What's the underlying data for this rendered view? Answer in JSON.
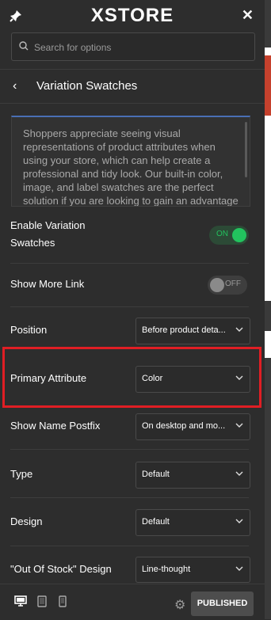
{
  "header": {
    "logo": "XSTORE",
    "close_label": "✕"
  },
  "search": {
    "placeholder": "Search for options"
  },
  "section": {
    "back_label": "‹",
    "title": "Variation Swatches"
  },
  "description": "Shoppers appreciate seeing visual representations of product attributes when using your store, which can help create a professional and tidy look. Our built-in color, image, and label swatches are the perfect solution if you are looking to gain an advantage",
  "settings": {
    "enable_swatches": {
      "label_line1": "Enable Variation",
      "label_line2": "Swatches",
      "state": "ON"
    },
    "show_more_link": {
      "label": "Show More Link",
      "state": "OFF"
    },
    "position": {
      "label": "Position",
      "value": "Before product deta..."
    },
    "primary_attribute": {
      "label": "Primary Attribute",
      "value": "Color"
    },
    "show_name_postfix": {
      "label": "Show Name Postfix",
      "value": "On desktop and mo..."
    },
    "type": {
      "label": "Type",
      "value": "Default"
    },
    "design": {
      "label": "Design",
      "value": "Default"
    },
    "out_of_stock_design": {
      "label": "\"Out Of Stock\" Design",
      "value": "Line-thought"
    }
  },
  "footer": {
    "publish_label": "PUBLISHED"
  },
  "colors": {
    "accent_green": "#22c35e",
    "highlight_red": "#e01e24",
    "panel_bg": "#2d2d2d"
  }
}
